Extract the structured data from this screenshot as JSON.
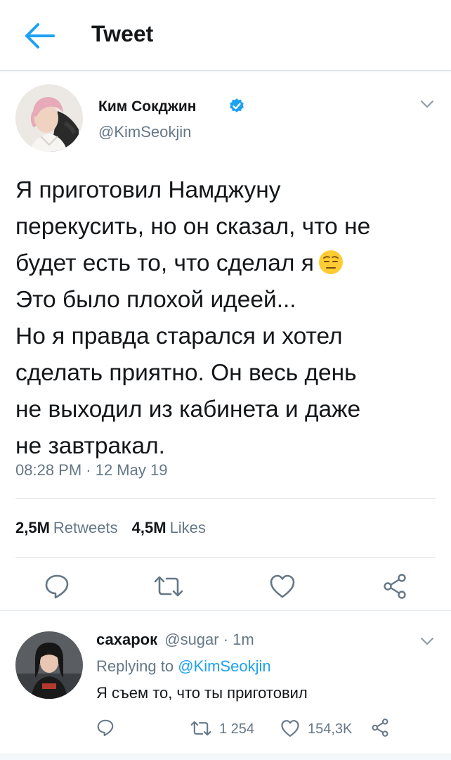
{
  "header": {
    "title": "Tweet",
    "back_icon": "arrow-left-icon",
    "accent": "#1da1f2"
  },
  "tweet": {
    "author": {
      "display_name": "Ким Сокджин",
      "handle": "@KimSeokjin",
      "verified": true
    },
    "text_lines": [
      "Я приготовил Намджуну",
      "перекусить, но он сказал, что не",
      "будет есть то, что сделал я",
      "Это было плохой идеей...",
      "Но я правда старался и хотел",
      "сделать приятно. Он весь день",
      "не выходил из кабинета и даже",
      "не завтракал."
    ],
    "emoji": "expressionless-face-emoji",
    "timestamp": "08:28 PM · 12 May 19",
    "stats": {
      "retweets": "2,5M",
      "retweets_label": "Retweets",
      "likes": "4,5M",
      "likes_label": "Likes"
    },
    "actions": [
      "reply-icon",
      "retweet-icon",
      "like-icon",
      "share-icon"
    ]
  },
  "reply": {
    "display_name": "сахарок",
    "handle": "@sugar",
    "time": "· 1m",
    "replying_to_label": "Replying to",
    "replying_to_handle": "@KimSeokjin",
    "text": "Я съем то, что ты приготовил",
    "retweet_count": "1 254",
    "like_count": "154,3K"
  },
  "colors": {
    "text": "#14171a",
    "secondary": "#657786",
    "accent": "#1da1f2",
    "divider": "#d7dde2"
  }
}
